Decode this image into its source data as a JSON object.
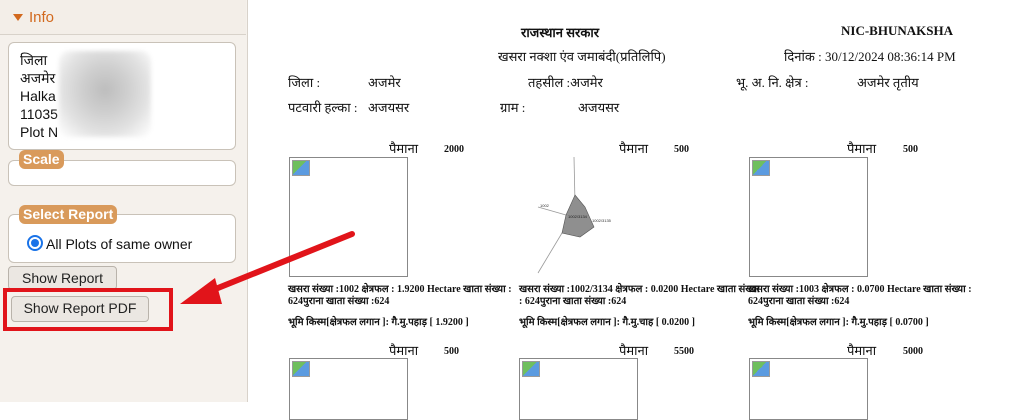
{
  "left_panel": {
    "info_label": "Info",
    "address_lines": [
      "जिला",
      "अजमेर",
      "Halka",
      "11035",
      "Plot N"
    ],
    "scale_label": "Scale",
    "select_report_label": "Select Report",
    "radio_label": "All Plots of same owner",
    "show_report_label": "Show Report",
    "show_report_pdf_label": "Show Report PDF"
  },
  "report": {
    "govt_title": "राजस्थान सरकार",
    "brand": "NIC-BHUNAKSHA",
    "subtitle": "खसरा नक्शा एंव जमाबंदी(प्रतिलिपि)",
    "date_text": "दिनांक : 30/12/2024 08:36:14 PM",
    "district_label": "जिला :",
    "district_value": "अजमेर",
    "tehsil_text": "तहसील :अजमेर",
    "bhu_label": "भू. अ. नि. क्षेत्र :",
    "bhu_value": "अजमेर तृतीय",
    "patwari_label": "पटवारी हल्का :",
    "patwari_value": "अजयसर",
    "gram_label": "ग्राम :",
    "gram_value": "अजयसर",
    "scale_word": "पैमाना",
    "plots": [
      {
        "scale": "2000",
        "info1": "खसरा संख्या :1002 क्षेत्रफल : 1.9200 Hectare खाता संख्या :",
        "info2": "624पुराना खाता संख्या :624",
        "land": "भूमि किस्म[क्षेत्रफल लगान ]: गै.मु.पहाड़ [ 1.9200 ]"
      },
      {
        "scale": "500",
        "info1": "खसरा संख्या :1002/3134 क्षेत्रफल : 0.0200 Hectare खाता संख्या",
        "info2": ": 624पुराना खाता संख्या :624",
        "land": "भूमि किस्म[क्षेत्रफल लगान ]: गै.मु.चाह [ 0.0200 ]",
        "map_labels": [
          "1002",
          "1002/3134",
          "1002/3135"
        ]
      },
      {
        "scale": "500",
        "info1": "खसरा संख्या :1003 क्षेत्रफल : 0.0700 Hectare खाता संख्या :",
        "info2": "624पुराना खाता संख्या :624",
        "land": "भूमि किस्म[क्षेत्रफल लगान ]: गै.मु.पहाड़ [ 0.0700 ]"
      }
    ],
    "row2_scales": [
      "500",
      "5500",
      "5000"
    ]
  },
  "colors": {
    "accent_orange": "#d2691e",
    "badge": "#d99a5b",
    "highlight_red": "#e1141a",
    "radio_blue": "#1a73e8"
  }
}
